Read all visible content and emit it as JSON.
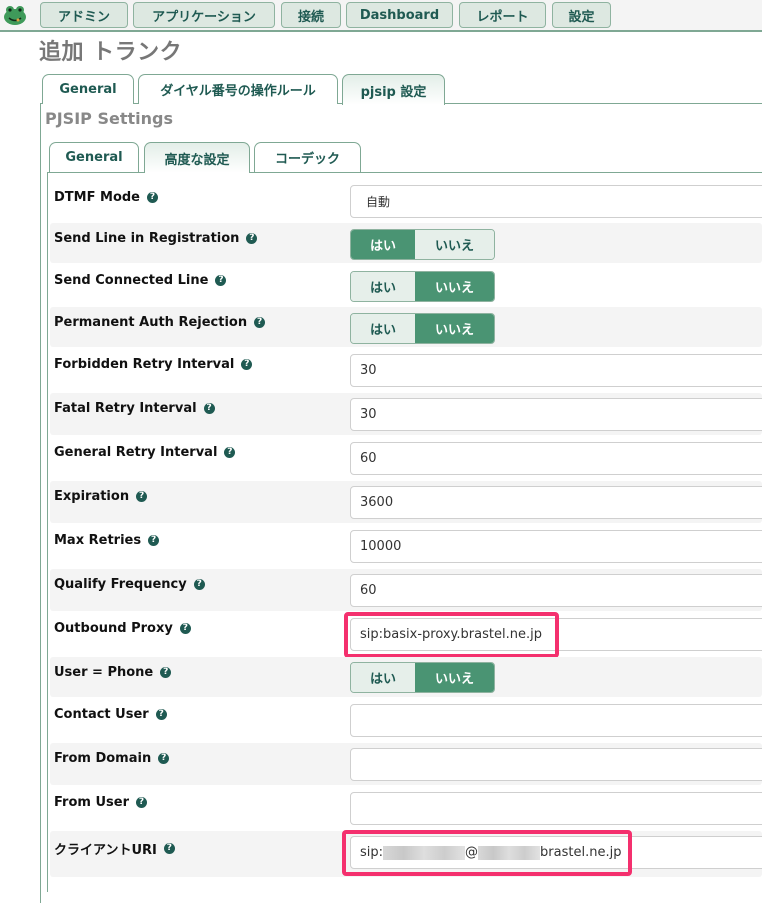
{
  "nav": {
    "logo_icon": "frog-logo-icon",
    "items": [
      {
        "label": "アドミン"
      },
      {
        "label": "アプリケーション"
      },
      {
        "label": "接続"
      },
      {
        "label": "Dashboard"
      },
      {
        "label": "レポート"
      },
      {
        "label": "設定"
      }
    ]
  },
  "page": {
    "title": "追加 トランク"
  },
  "outer_tabs": [
    {
      "label": "General",
      "active": false
    },
    {
      "label": "ダイヤル番号の操作ルール",
      "active": false
    },
    {
      "label": "pjsip 設定",
      "active": true
    }
  ],
  "section": {
    "title": "PJSIP Settings"
  },
  "inner_tabs": [
    {
      "label": "General",
      "active": false
    },
    {
      "label": "高度な設定",
      "active": true
    },
    {
      "label": "コーデック",
      "active": false
    }
  ],
  "toggle_labels": {
    "yes": "はい",
    "no": "いいえ"
  },
  "help_icon_glyph": "?",
  "fields": [
    {
      "label": "DTMF Mode",
      "type": "select",
      "value": "自動"
    },
    {
      "label": "Send Line in Registration",
      "type": "toggle",
      "value": "yes"
    },
    {
      "label": "Send Connected Line",
      "type": "toggle",
      "value": "no"
    },
    {
      "label": "Permanent Auth Rejection",
      "type": "toggle",
      "value": "no"
    },
    {
      "label": "Forbidden Retry Interval",
      "type": "text",
      "value": "30"
    },
    {
      "label": "Fatal Retry Interval",
      "type": "text",
      "value": "30"
    },
    {
      "label": "General Retry Interval",
      "type": "text",
      "value": "60"
    },
    {
      "label": "Expiration",
      "type": "text",
      "value": "3600"
    },
    {
      "label": "Max Retries",
      "type": "text",
      "value": "10000"
    },
    {
      "label": "Qualify Frequency",
      "type": "text",
      "value": "60"
    },
    {
      "label": "Outbound Proxy",
      "type": "text",
      "value": "sip:basix-proxy.brastel.ne.jp",
      "highlighted": true
    },
    {
      "label": "User = Phone",
      "type": "toggle",
      "value": "no"
    },
    {
      "label": "Contact User",
      "type": "text",
      "value": ""
    },
    {
      "label": "From Domain",
      "type": "text",
      "value": ""
    },
    {
      "label": "From User",
      "type": "text",
      "value": ""
    },
    {
      "label": "クライアントURI",
      "type": "text",
      "value_prefix": "sip:",
      "value_mid": "@",
      "value_suffix": "brastel.ne.jp",
      "redacted": true,
      "highlighted": true
    }
  ],
  "colors": {
    "accent": "#4a9473",
    "nav_text": "#1f5a52",
    "highlight": "#f4306e"
  }
}
